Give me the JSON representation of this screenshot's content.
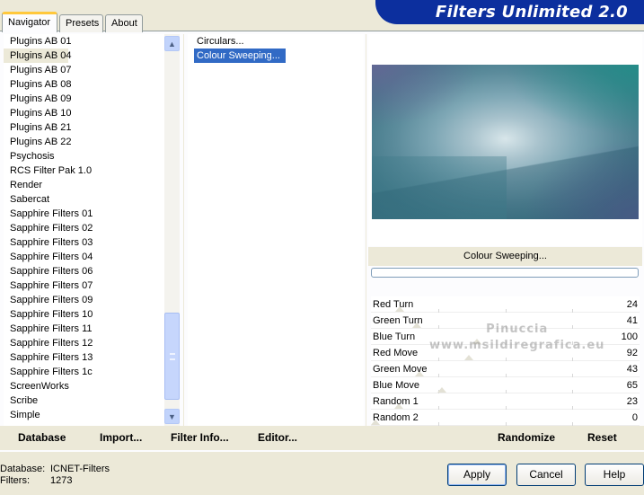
{
  "tabs": [
    {
      "label": "Navigator",
      "active": true
    },
    {
      "label": "Presets",
      "active": false
    },
    {
      "label": "About",
      "active": false
    }
  ],
  "app_title": "Filters Unlimited 2.0",
  "categories": [
    "Plugins AB 01",
    "Plugins AB 04",
    "Plugins AB 07",
    "Plugins AB 08",
    "Plugins AB 09",
    "Plugins AB 10",
    "Plugins AB 21",
    "Plugins AB 22",
    "Psychosis",
    "RCS Filter Pak 1.0",
    "Render",
    "Sabercat",
    "Sapphire Filters 01",
    "Sapphire Filters 02",
    "Sapphire Filters 03",
    "Sapphire Filters 04",
    "Sapphire Filters 06",
    "Sapphire Filters 07",
    "Sapphire Filters 09",
    "Sapphire Filters 10",
    "Sapphire Filters 11",
    "Sapphire Filters 12",
    "Sapphire Filters 13",
    "Sapphire Filters 1c",
    "ScreenWorks",
    "Scribe",
    "Simple"
  ],
  "selected_category": "Plugins AB 04",
  "filters": [
    "Circulars...",
    "Colour Sweeping..."
  ],
  "selected_filter": "Colour Sweeping...",
  "preview_filter_name": "Colour Sweeping...",
  "watermark": [
    "Pinuccia",
    "www.msildiregrafica.eu"
  ],
  "parameters": [
    {
      "label": "Red Turn",
      "value": "24",
      "level": 24
    },
    {
      "label": "Green Turn",
      "value": "41",
      "level": 41
    },
    {
      "label": "Blue Turn",
      "value": "100",
      "level": 100
    },
    {
      "label": "Red Move",
      "value": "92",
      "level": 92
    },
    {
      "label": "Green Move",
      "value": "43",
      "level": 43
    },
    {
      "label": "Blue Move",
      "value": "65",
      "level": 65
    },
    {
      "label": "Random 1",
      "value": "23",
      "level": 23
    },
    {
      "label": "Random 2",
      "value": "0",
      "level": 0
    }
  ],
  "toolbar": {
    "database": "Database",
    "import": "Import...",
    "filter_info": "Filter Info...",
    "editor": "Editor...",
    "randomize": "Randomize",
    "reset": "Reset"
  },
  "status": {
    "database_label": "Database:",
    "database_value": "ICNET-Filters",
    "filters_label": "Filters:",
    "filters_value": "1273"
  },
  "buttons": {
    "apply": "Apply",
    "cancel": "Cancel",
    "help": "Help"
  },
  "colors": {
    "banner": "#0c2f9e",
    "selection": "#316ac5",
    "tab_highlight": "#ffc83c"
  }
}
